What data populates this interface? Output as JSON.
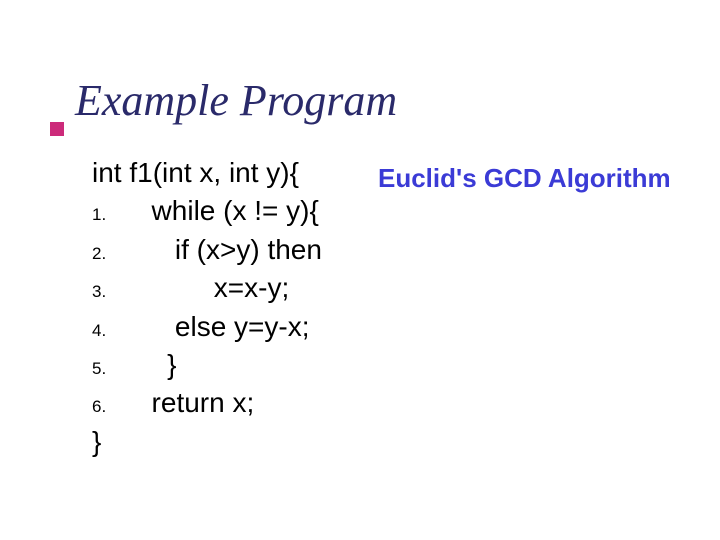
{
  "title": "Example Program",
  "annotation": "Euclid's GCD Algorithm",
  "code": {
    "signature": "int f1(int x, int y){",
    "lines": [
      {
        "n": "1.",
        "text": "  while (x != y){"
      },
      {
        "n": "2.",
        "text": "     if (x>y) then"
      },
      {
        "n": "3.",
        "text": "          x=x-y;"
      },
      {
        "n": "4.",
        "text": "     else y=y-x;"
      },
      {
        "n": "5.",
        "text": "    }"
      },
      {
        "n": "6.",
        "text": "  return x;"
      }
    ],
    "close": "}"
  }
}
